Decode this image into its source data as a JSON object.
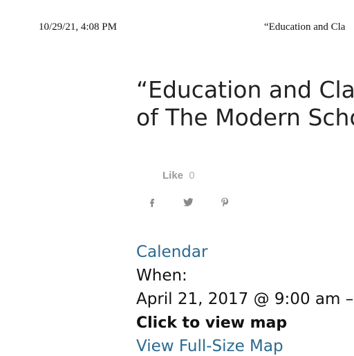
{
  "print_header": {
    "date": "10/29/21, 4:08 PM",
    "title": "“Education and Cla"
  },
  "page": {
    "title_line1": "“Education and Clas",
    "title_line2": "of The Modern Scho"
  },
  "social": {
    "like_label": "Like",
    "like_count": "0",
    "icons": [
      "facebook-icon",
      "twitter-icon",
      "pinterest-icon"
    ],
    "icon_color": "#8a8a8a"
  },
  "event": {
    "calendar_link": "Calendar",
    "when_label": "When:",
    "when_value": "April 21, 2017 @ 9:00 am –",
    "map_link": "Click to view map",
    "full_map_link": "View Full-Size Map"
  },
  "colors": {
    "link": "#2b6a8f",
    "text": "#111111"
  }
}
